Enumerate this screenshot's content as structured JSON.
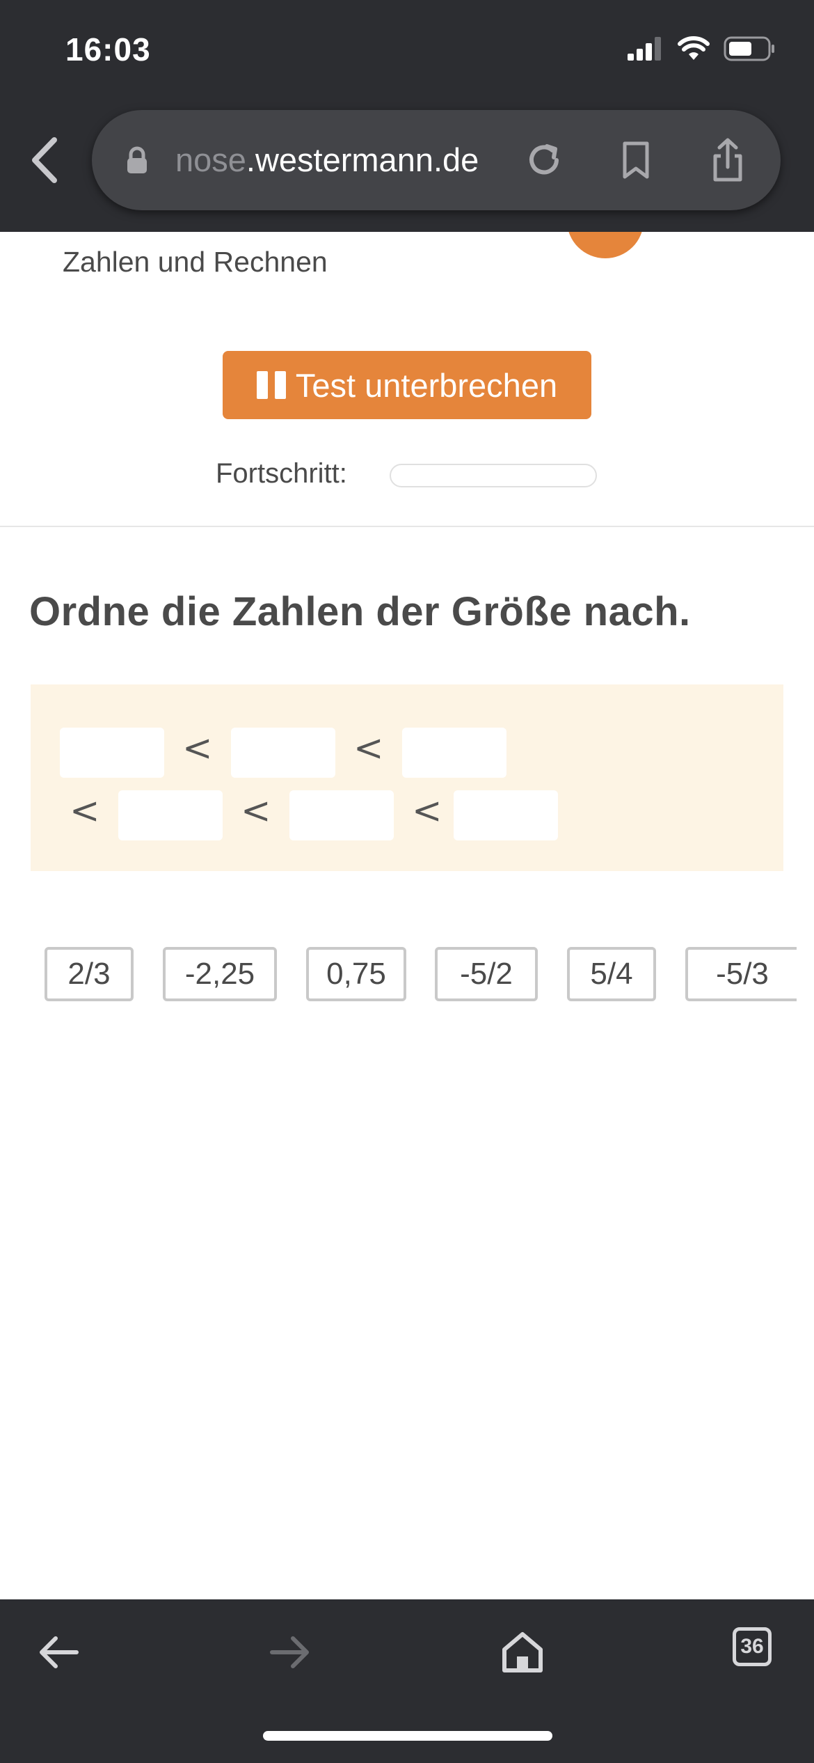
{
  "status_bar": {
    "time": "16:03"
  },
  "browser": {
    "url_faded": "nose",
    "url_main": ".westermann.de"
  },
  "page": {
    "subject": "Zahlen und Rechnen",
    "pause_button_label": "Test unterbrechen",
    "progress_label": "Fortschritt:",
    "progress_fraction": 0.0,
    "question": "Ordne die Zahlen der Größe nach.",
    "comparison_symbol": "<",
    "tiles": [
      "2/3",
      "-2,25",
      "0,75",
      "-5/2",
      "5/4",
      "-5/3"
    ]
  },
  "toolbar": {
    "tab_count": "36"
  },
  "colors": {
    "accent": "#e5853b",
    "chrome": "#2c2d31",
    "answer_bg": "#fdf4e4"
  }
}
